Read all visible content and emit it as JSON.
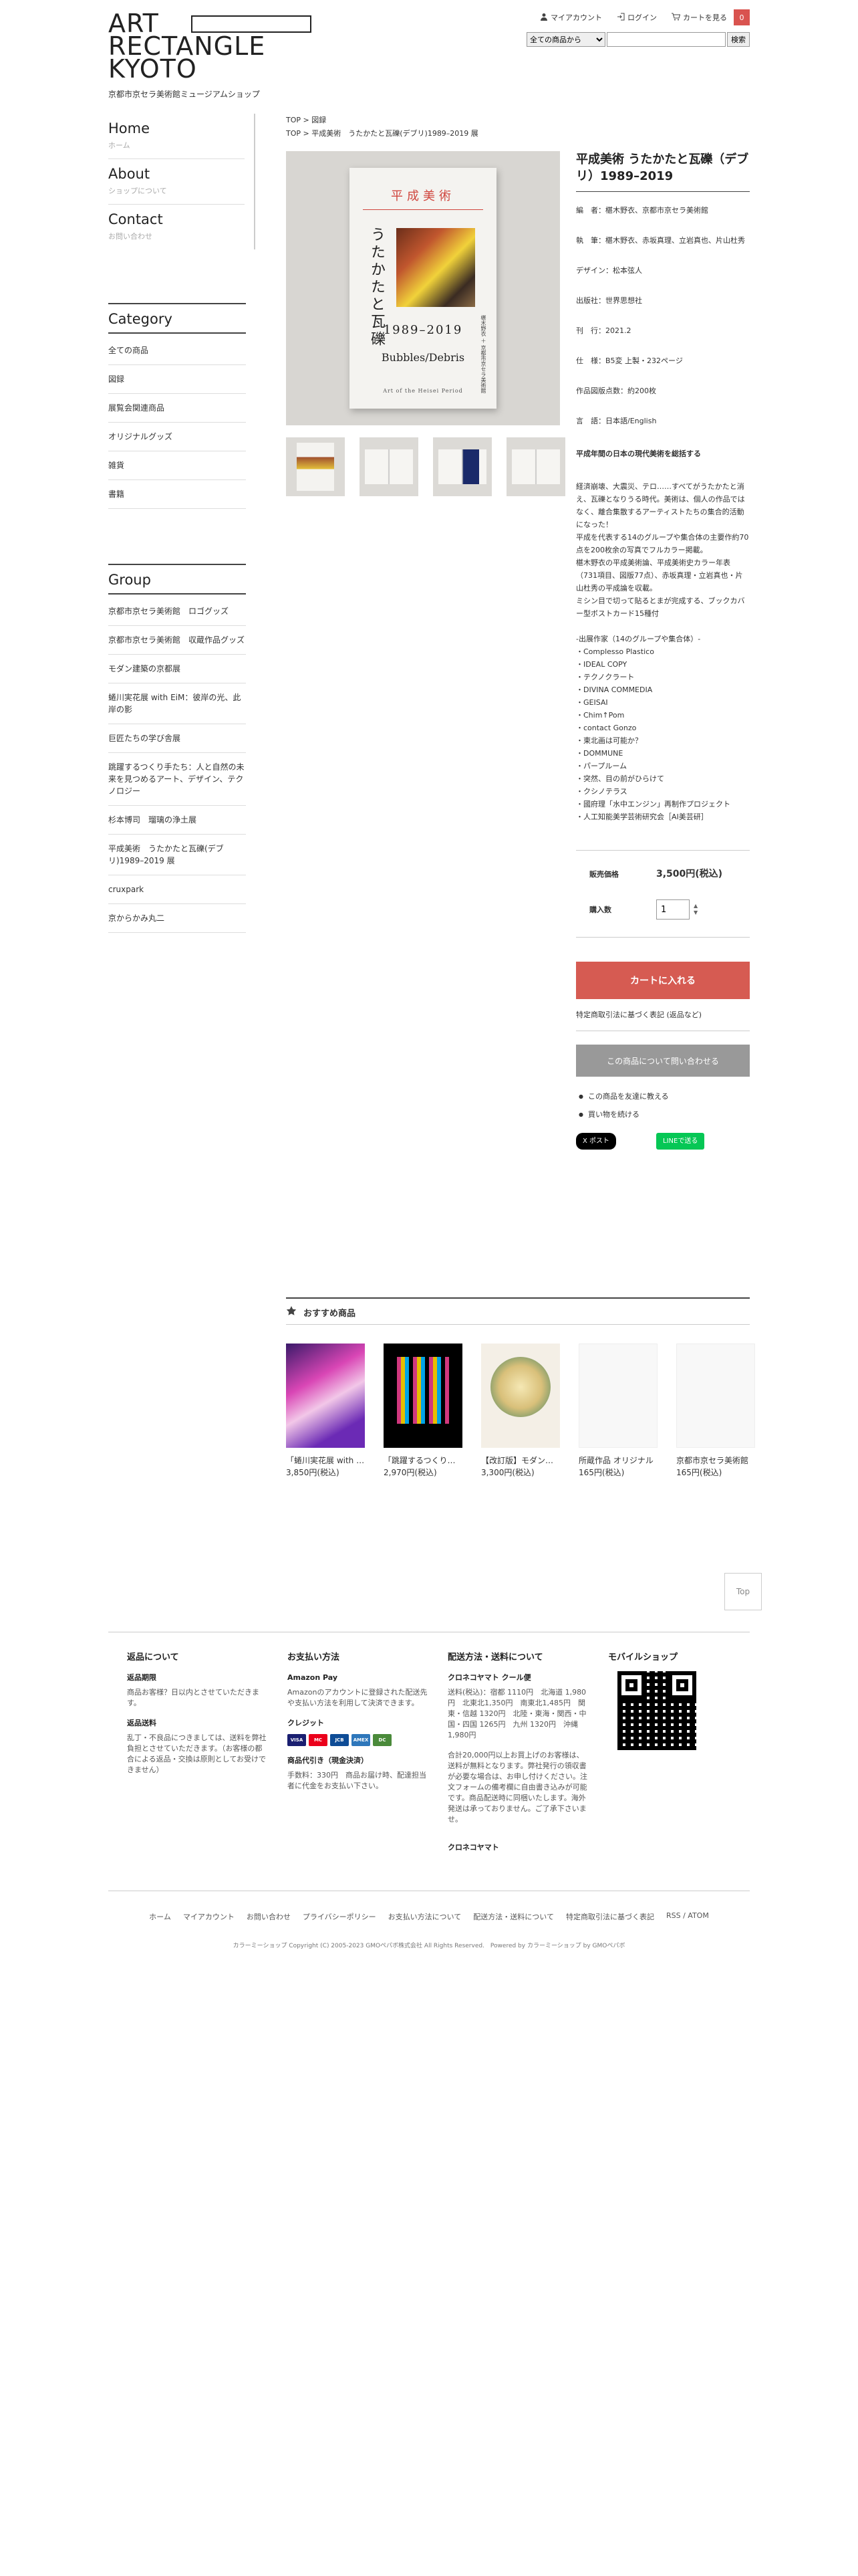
{
  "header": {
    "logo_lines": [
      "ART",
      "RECTANGLE",
      "KYOTO"
    ],
    "shop_subtitle": "京都市京セラ美術館ミュージアムショップ",
    "links": {
      "account": "マイアカウント",
      "login": "ログイン",
      "cart": "カートを見る",
      "cart_count": "0"
    },
    "search": {
      "category_selected": "全ての商品から",
      "button": "検索"
    }
  },
  "sidebar": {
    "nav": [
      {
        "en": "Home",
        "jp": "ホーム"
      },
      {
        "en": "About",
        "jp": "ショップについて"
      },
      {
        "en": "Contact",
        "jp": "お問い合わせ"
      }
    ],
    "category_title": "Category",
    "categories": [
      "全ての商品",
      "図録",
      "展覧会関連商品",
      "オリジナルグッズ",
      "雑貨",
      "書籍"
    ],
    "group_title": "Group",
    "groups": [
      "京都市京セラ美術館　ロゴグッズ",
      "京都市京セラ美術館　収蔵作品グッズ",
      "モダン建築の京都展",
      "蜷川実花展 with EiM：彼岸の光、此岸の影",
      "巨匠たちの学び舎展",
      "跳躍するつくり手たち：人と自然の未来を見つめるアート、デザイン、テクノロジー",
      "杉本博司　瑠璃の浄土展",
      "平成美術　うたかたと瓦礫(デブリ)1989–2019 展",
      "cruxpark",
      "京からかみ丸二"
    ]
  },
  "breadcrumb": {
    "line1": [
      "TOP",
      "図録"
    ],
    "line2": [
      "TOP",
      "平成美術　うたかたと瓦礫(デブリ)1989–2019 展"
    ]
  },
  "cover": {
    "title": "平成美術",
    "vertical": "うたかたと瓦礫",
    "years": "1989–2019",
    "subtitle": "Bubbles/Debris",
    "foot": "Art of the Heisei Period",
    "vert_author": "椹木野衣 ＋ 京都市京セラ美術館"
  },
  "product": {
    "title": "平成美術 うたかたと瓦礫（デブリ）1989–2019",
    "specs": [
      "編　者：椹木野衣、京都市京セラ美術館",
      "執　筆：椹木野衣、赤坂真理、立岩真也、片山杜秀",
      "デザイン：松本弦人",
      "出版社：世界思想社",
      "刊　行：2021.2",
      "仕　様：B5変 上製・232ページ",
      "作品図版点数：約200枚",
      "言　語：日本語/English"
    ],
    "desc_head": "平成年間の日本の現代美術を総括する",
    "desc": [
      "経済崩壊、大震災、テロ……すべてがうたかたと消え、瓦礫となりうる時代。美術は、個人の作品ではなく、離合集散するアーティストたちの集合的活動になった！",
      "平成を代表する14のグループや集合体の主要作約70点を200枚余の写真でフルカラー掲載。",
      "椹木野衣の平成美術論、平成美術史カラー年表（731項目、図版77点）、赤坂真理・立岩真也・片山杜秀の平成論を収載。",
      "ミシン目で切って貼るとまが完成する、ブックカバー型ボストカード15種付"
    ],
    "groups_head": "-出展作家（14のグループや集合体）-",
    "groups": [
      "・Complesso Plastico",
      "・IDEAL COPY",
      "・テクノクラート",
      "・DIVINA COMMEDIA",
      "・GEISAI",
      "・Chim↑Pom",
      "・contact Gonzo",
      "・東北画は可能か？",
      "・DOMMUNE",
      "・パープルーム",
      "・突然、目の前がひらけて",
      "・クシノテラス",
      "・國府理「水中エンジン」再制作プロジェクト",
      "・人工知能美学芸術研究会［AI美芸研］"
    ],
    "price_label": "販売価格",
    "price": "3,500円(税込)",
    "qty_label": "購入数",
    "qty": "1",
    "cart_button": "カートに入れる",
    "law_link": "特定商取引法に基づく表記 (返品など)",
    "inquiry_button": "この商品について問い合わせる",
    "sub_links": [
      "この商品を友達に教える",
      "買い物を続ける"
    ],
    "share_x": "X ポスト",
    "share_line": "LINEで送る"
  },
  "recommend": {
    "title": "おすすめ商品",
    "items": [
      {
        "name": "「蜷川実花展 with EiM：彼岸の光、此岸の影」",
        "price": "3,850円(税込)"
      },
      {
        "name": "「跳躍するつくり手たち」",
        "price": "2,970円(税込)"
      },
      {
        "name": "【改訂版】モダン建築の京都",
        "price": "3,300円(税込)"
      },
      {
        "name": "所蔵作品 オリジナル",
        "price": "165円(税込)"
      },
      {
        "name": "京都市京セラ美術館",
        "price": "165円(税込)"
      }
    ]
  },
  "pagetop": "Top",
  "footer": {
    "col1": {
      "title": "返品について",
      "h1": "返品期限",
      "t1": "商品お客様？日以内とさせていただきます。",
      "h2": "返品送料",
      "t2": "乱丁・不良品につきましては、送料を弊社負担とさせていただきます。（お客様の都合による返品・交換は原則としてお受けできません）"
    },
    "col2": {
      "title": "お支払い方法",
      "h1": "Amazon Pay",
      "t1": "Amazonのアカウントに登録された配送先や支払い方法を利用して決済できます。",
      "h2": "クレジット",
      "cards": [
        "VISA",
        "MC",
        "JCB",
        "AMEX",
        "DC"
      ],
      "h3": "商品代引き（現金決済）",
      "t3": "手数料：330円　商品お届け時、配達担当者に代金をお支払い下さい。"
    },
    "col3": {
      "title": "配送方法・送料について",
      "h1": "クロネコヤマト クール便",
      "t1": "送料(税込)：宿都 1110円　北海道 1,980円　北東北1,350円　南東北1,485円　関東・信越 1320円　北陸・東海・関西・中国・四国 1265円　九州 1320円　沖縄 1,980円",
      "t2": "合計20,000円以上お買上げのお客様は、送料が無料となります。弊社発行の領収書が必要な場合は、お申し付けください。注文フォームの備考欄に自由書き込みが可能です。商品配送時に同梱いたします。海外発送は承っておりません。ご了承下さいませ。",
      "h2": "クロネコヤマト"
    },
    "col4": {
      "title": "モバイルショップ"
    },
    "nav": [
      "ホーム",
      "マイアカウント",
      "お問い合わせ",
      "プライバシーポリシー",
      "お支払い方法について",
      "配送方法・送料について",
      "特定商取引法に基づく表記",
      "RSS / ATOM"
    ],
    "copyright": "カラーミーショップ Copyright (C) 2005-2023 GMOペパボ株式会社 All Rights Reserved.　Powered by カラーミーショップ by GMOペパボ"
  },
  "colors": {
    "cart_button": "#d65b52",
    "inquiry_button": "#999999",
    "cart_badge": "#d9534f"
  }
}
